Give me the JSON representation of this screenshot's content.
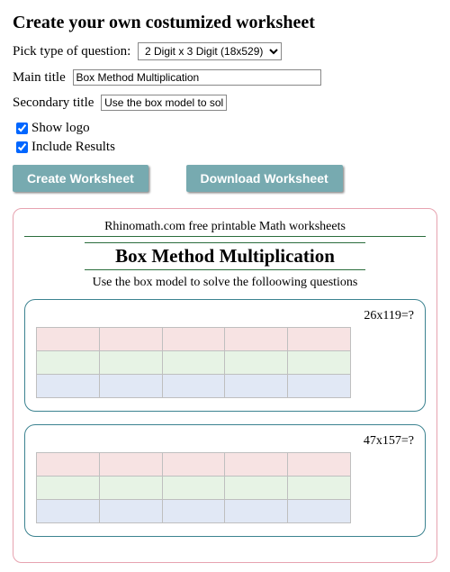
{
  "heading": "Create your own costumized worksheet",
  "form": {
    "type_label": "Pick type of question:",
    "type_value": "2 Digit x 3 Digit (18x529)",
    "main_label": "Main title",
    "main_value": "Box Method Multiplication",
    "secondary_label": "Secondary title",
    "secondary_value": "Use the box model to sol",
    "show_logo": "Show logo",
    "include_results": "Include Results",
    "create_btn": "Create Worksheet",
    "download_btn": "Download Worksheet"
  },
  "preview": {
    "site_line": "Rhinomath.com free printable Math worksheets",
    "title": "Box Method Multiplication",
    "subtitle": "Use the box model to solve the folloowing questions",
    "problems": [
      {
        "prompt": "26x119=?"
      },
      {
        "prompt": "47x157=?"
      }
    ]
  }
}
